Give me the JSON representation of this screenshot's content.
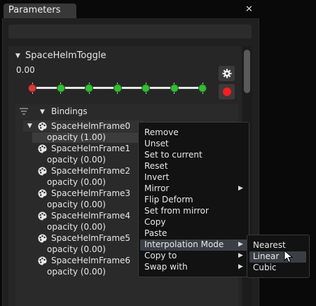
{
  "window": {
    "tab_title": "Parameters",
    "close_glyph": "✕"
  },
  "parameter": {
    "name": "SpaceHelmToggle",
    "value": "0.00",
    "keyframe_count": 7,
    "active_keyframe_index": 0,
    "key_active_color": "#d43b3b",
    "key_color": "#2fbf2f"
  },
  "buttons": {
    "settings_icon": "gear-icon",
    "record_icon": "record-dot-icon"
  },
  "bindings": {
    "label": "Bindings",
    "frames": [
      {
        "name": "SpaceHelmFrame0",
        "value": "opacity (1.00)"
      },
      {
        "name": "SpaceHelmFrame1",
        "value": "opacity (0.00)"
      },
      {
        "name": "SpaceHelmFrame2",
        "value": "opacity (0.00)"
      },
      {
        "name": "SpaceHelmFrame3",
        "value": "opacity (0.00)"
      },
      {
        "name": "SpaceHelmFrame4",
        "value": "opacity (0.00)"
      },
      {
        "name": "SpaceHelmFrame5",
        "value": "opacity (0.00)"
      },
      {
        "name": "SpaceHelmFrame6",
        "value": "opacity (0.00)"
      }
    ]
  },
  "context_menu": {
    "items": [
      "Remove",
      "Unset",
      "Set to current",
      "Reset",
      "Invert",
      "Mirror",
      "Flip Deform",
      "Set from mirror",
      "Copy",
      "Paste",
      "Interpolation Mode",
      "Copy to",
      "Swap with"
    ],
    "submenu_arrow": "▶",
    "highlighted": "Interpolation Mode"
  },
  "submenu": {
    "items": [
      "Nearest",
      "Linear",
      "Cubic"
    ],
    "highlighted": "Linear"
  }
}
